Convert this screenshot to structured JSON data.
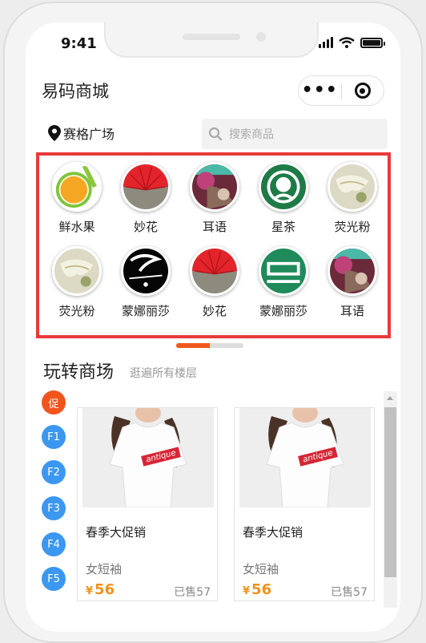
{
  "status_bar": {
    "time": "9:41"
  },
  "header": {
    "title": "易码商城",
    "capsule_more": "•••"
  },
  "location": {
    "name": "赛格广场"
  },
  "search": {
    "placeholder": "搜索商品"
  },
  "categories": [
    {
      "label": "鲜水果",
      "image": "orange-slice"
    },
    {
      "label": "妙花",
      "image": "red-paper-fan"
    },
    {
      "label": "耳语",
      "image": "flower-photo"
    },
    {
      "label": "星茶",
      "image": "green-logo"
    },
    {
      "label": "荧光粉",
      "image": "noodle-dish"
    },
    {
      "label": "荧光粉",
      "image": "noodle-dish"
    },
    {
      "label": "蒙娜丽莎",
      "image": "black-script-logo"
    },
    {
      "label": "妙花",
      "image": "red-paper-fan"
    },
    {
      "label": "蒙娜丽莎",
      "image": "green-sign"
    },
    {
      "label": "耳语",
      "image": "flower-photo"
    }
  ],
  "section": {
    "title": "玩转商场",
    "subtitle": "逛遍所有楼层"
  },
  "floors": [
    "促",
    "F1",
    "F2",
    "F3",
    "F4",
    "F5"
  ],
  "products": [
    {
      "name": "春季大促销",
      "subtitle": "女短袖",
      "currency": "¥",
      "price": "56",
      "sold": "已售57",
      "shirt_label": "antique"
    },
    {
      "name": "春季大促销",
      "subtitle": "女短袖",
      "currency": "¥",
      "price": "56",
      "sold": "已售57",
      "shirt_label": "antique"
    }
  ],
  "colors": {
    "highlight_border": "#e83a3a",
    "accent": "#f0581e",
    "floor_button": "#3b97f0",
    "price": "#f0921e"
  }
}
